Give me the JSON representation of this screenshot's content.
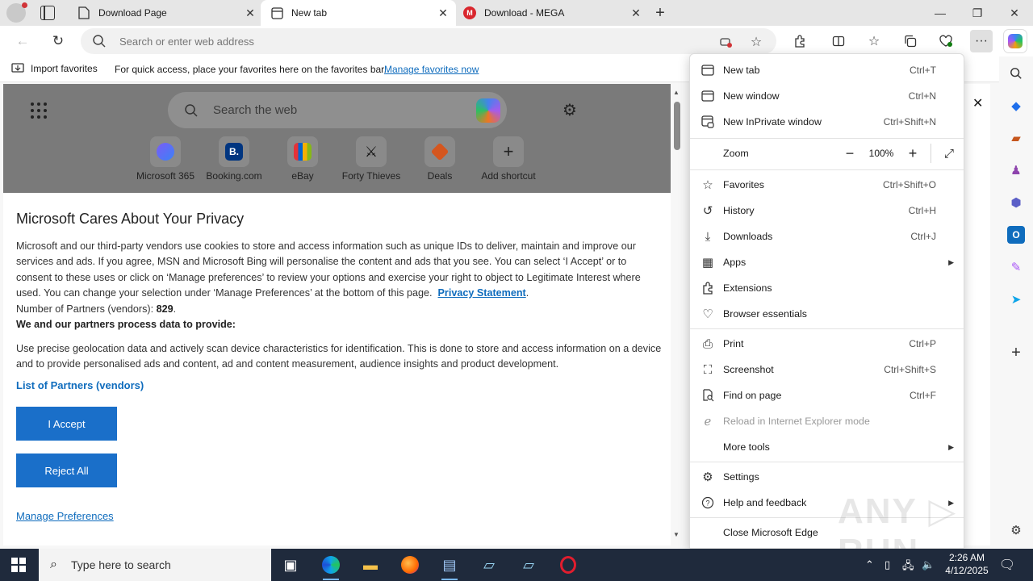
{
  "tabs": [
    {
      "title": "Download Page",
      "active": false
    },
    {
      "title": "New tab",
      "active": true
    },
    {
      "title": "Download - MEGA",
      "active": false
    }
  ],
  "address_bar": {
    "placeholder": "Search or enter web address"
  },
  "favorites_bar": {
    "import_label": "Import favorites",
    "hint": "For quick access, place your favorites here on the favorites bar.",
    "manage_link": "Manage favorites now"
  },
  "new_tab_page": {
    "search_placeholder": "Search the web",
    "shortcuts": [
      {
        "label": "Microsoft 365",
        "icon": "microsoft-365-icon"
      },
      {
        "label": "Booking.com",
        "icon": "booking-icon"
      },
      {
        "label": "eBay",
        "icon": "ebay-icon"
      },
      {
        "label": "Forty Thieves",
        "icon": "forty-thieves-icon"
      },
      {
        "label": "Deals",
        "icon": "deals-icon"
      },
      {
        "label": "Add shortcut",
        "icon": "plus-icon"
      }
    ]
  },
  "privacy": {
    "title": "Microsoft Cares About Your Privacy",
    "para1": "Microsoft and our third-party vendors use cookies to store and access information such as unique IDs to deliver, maintain and improve our services and ads. If you agree, MSN and Microsoft Bing will personalise the content and ads that you see. You can select ‘I Accept’ or to consent to these uses or click on ‘Manage preferences’ to review your options and exercise your right to object to Legitimate Interest where used.  You can change your selection under ‘Manage Preferences’ at the bottom of this page.",
    "privacy_statement": "Privacy Statement",
    "partners_label": "Number of Partners (vendors):",
    "partners_count": "829",
    "process_heading": "We and our partners process data to provide:",
    "para2": "Use precise geolocation data and actively scan device characteristics for identification. This is done to store and access information on a device and to provide personalised ads and content, ad and content measurement, audience insights and product development.",
    "list_partners": "List of Partners (vendors)",
    "accept": "I Accept",
    "reject": "Reject All",
    "manage": "Manage Preferences"
  },
  "menu": {
    "items": [
      {
        "label": "New tab",
        "shortcut": "Ctrl+T",
        "icon": "new-tab-icon"
      },
      {
        "label": "New window",
        "shortcut": "Ctrl+N",
        "icon": "new-window-icon"
      },
      {
        "label": "New InPrivate window",
        "shortcut": "Ctrl+Shift+N",
        "icon": "inprivate-icon"
      },
      {
        "label": "Zoom",
        "value": "100%"
      },
      {
        "label": "Favorites",
        "shortcut": "Ctrl+Shift+O",
        "icon": "favorites-icon"
      },
      {
        "label": "History",
        "shortcut": "Ctrl+H",
        "icon": "history-icon"
      },
      {
        "label": "Downloads",
        "shortcut": "Ctrl+J",
        "icon": "downloads-icon"
      },
      {
        "label": "Apps",
        "icon": "apps-icon"
      },
      {
        "label": "Extensions",
        "icon": "extensions-icon"
      },
      {
        "label": "Browser essentials",
        "icon": "heart-pulse-icon"
      },
      {
        "label": "Print",
        "shortcut": "Ctrl+P",
        "icon": "print-icon"
      },
      {
        "label": "Screenshot",
        "shortcut": "Ctrl+Shift+S",
        "icon": "screenshot-icon"
      },
      {
        "label": "Find on page",
        "shortcut": "Ctrl+F",
        "icon": "find-icon"
      },
      {
        "label": "Reload in Internet Explorer mode",
        "icon": "ie-icon"
      },
      {
        "label": "More tools"
      },
      {
        "label": "Settings",
        "icon": "settings-icon"
      },
      {
        "label": "Help and feedback",
        "icon": "help-icon"
      },
      {
        "label": "Close Microsoft Edge"
      }
    ]
  },
  "taskbar": {
    "search_text": "Type here to search",
    "time": "2:26 AM",
    "date": "4/12/2025"
  },
  "watermark": "ANY RUN",
  "colors": {
    "accent": "#0f6cbd",
    "button_blue": "#1a6fc9",
    "taskbar": "#1f2a3c"
  }
}
